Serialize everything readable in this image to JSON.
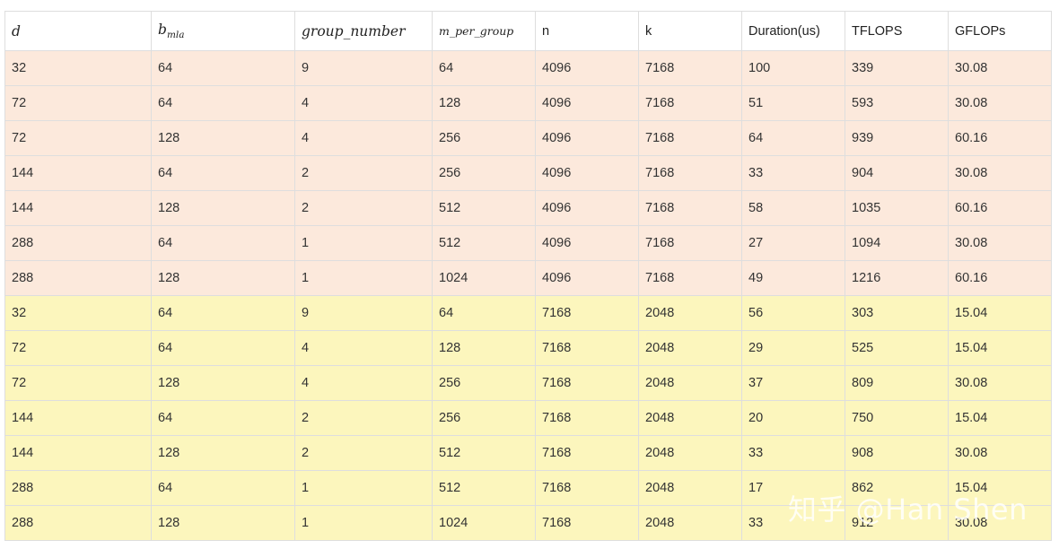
{
  "table": {
    "headers": {
      "d": "d",
      "b_base": "b",
      "b_sub": "mla",
      "group_number": "group_number",
      "m_per_group": "m_per_group",
      "n": "n",
      "k": "k",
      "duration": "Duration(us)",
      "tflops": "TFLOPS",
      "gflops": "GFLOPs"
    },
    "rows": [
      [
        "32",
        "64",
        "9",
        "64",
        "4096",
        "7168",
        "100",
        "339",
        "30.08"
      ],
      [
        "72",
        "64",
        "4",
        "128",
        "4096",
        "7168",
        "51",
        "593",
        "30.08"
      ],
      [
        "72",
        "128",
        "4",
        "256",
        "4096",
        "7168",
        "64",
        "939",
        "60.16"
      ],
      [
        "144",
        "64",
        "2",
        "256",
        "4096",
        "7168",
        "33",
        "904",
        "30.08"
      ],
      [
        "144",
        "128",
        "2",
        "512",
        "4096",
        "7168",
        "58",
        "1035",
        "60.16"
      ],
      [
        "288",
        "64",
        "1",
        "512",
        "4096",
        "7168",
        "27",
        "1094",
        "30.08"
      ],
      [
        "288",
        "128",
        "1",
        "1024",
        "4096",
        "7168",
        "49",
        "1216",
        "60.16"
      ],
      [
        "32",
        "64",
        "9",
        "64",
        "7168",
        "2048",
        "56",
        "303",
        "15.04"
      ],
      [
        "72",
        "64",
        "4",
        "128",
        "7168",
        "2048",
        "29",
        "525",
        "15.04"
      ],
      [
        "72",
        "128",
        "4",
        "256",
        "7168",
        "2048",
        "37",
        "809",
        "30.08"
      ],
      [
        "144",
        "64",
        "2",
        "256",
        "7168",
        "2048",
        "20",
        "750",
        "15.04"
      ],
      [
        "144",
        "128",
        "2",
        "512",
        "7168",
        "2048",
        "33",
        "908",
        "30.08"
      ],
      [
        "288",
        "64",
        "1",
        "512",
        "7168",
        "2048",
        "17",
        "862",
        "15.04"
      ],
      [
        "288",
        "128",
        "1",
        "1024",
        "7168",
        "2048",
        "33",
        "912",
        "30.08"
      ]
    ],
    "row_groups": [
      "a",
      "a",
      "a",
      "a",
      "a",
      "a",
      "a",
      "b",
      "b",
      "b",
      "b",
      "b",
      "b",
      "b"
    ]
  },
  "colors": {
    "group_a_background": "#fce9dc",
    "group_b_background": "#fcf6bd",
    "border": "#dedede"
  },
  "watermark": "知乎 @Han Shen"
}
